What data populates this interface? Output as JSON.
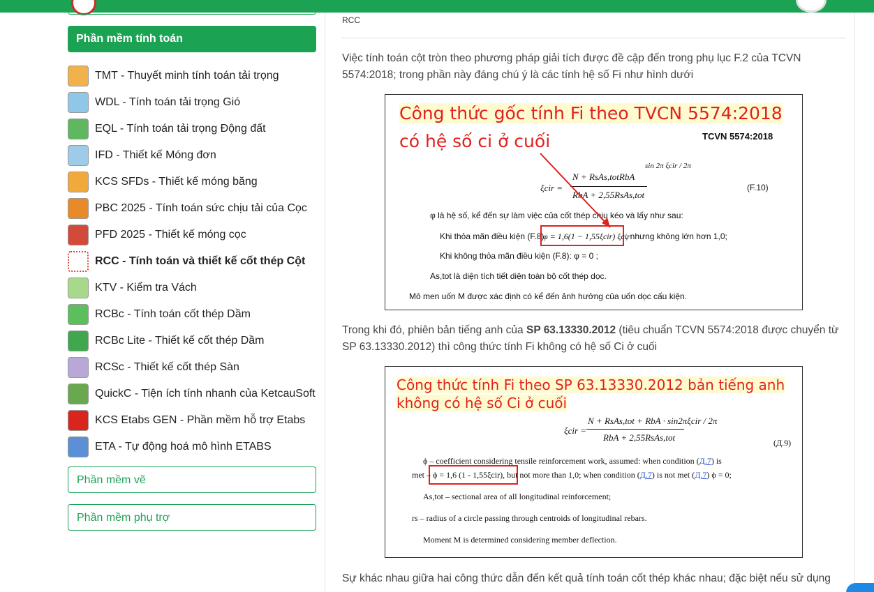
{
  "sidebar": {
    "active_header": "Phần mềm tính toán",
    "items": [
      {
        "label": "TMT - Thuyết minh tính toán tải trọng",
        "icon": "tmt-app-icon",
        "color": "#f2b24b"
      },
      {
        "label": "WDL - Tính toán tải trọng Gió",
        "icon": "wdl-app-icon",
        "color": "#8fc7e8"
      },
      {
        "label": "EQL - Tính toán tải trọng Động đất",
        "icon": "eql-app-icon",
        "color": "#5fb85f"
      },
      {
        "label": "IFD - Thiết kế Móng đơn",
        "icon": "ifd-app-icon",
        "color": "#9ecbe8"
      },
      {
        "label": "KCS SFDs - Thiết kế móng băng",
        "icon": "kcs-sfds-app-icon",
        "color": "#f2a93b"
      },
      {
        "label": "PBC 2025 - Tính toán sức chịu tải của Cọc",
        "icon": "pbc-app-icon",
        "color": "#e98a2a"
      },
      {
        "label": "PFD 2025 - Thiết kế móng cọc",
        "icon": "pfd-app-icon",
        "color": "#d24a3a"
      },
      {
        "label": "RCC - Tính toán và thiết kế cốt thép Cột",
        "icon": "rcc-app-icon",
        "color": "#ffffff",
        "active": true
      },
      {
        "label": "KTV - Kiểm tra Vách",
        "icon": "ktv-app-icon",
        "color": "#a8d98a"
      },
      {
        "label": "RCBc - Tính toán cốt thép Dầm",
        "icon": "rcbc-app-icon",
        "color": "#5cbf5c"
      },
      {
        "label": "RCBc Lite - Thiết kế cốt thép Dầm",
        "icon": "rcbc-lite-app-icon",
        "color": "#3fa84f"
      },
      {
        "label": "RCSc - Thiết kế cốt thép Sàn",
        "icon": "rcsc-app-icon",
        "color": "#b9a7d8"
      },
      {
        "label": "QuickC - Tiện ích tính nhanh của KetcauSoft",
        "icon": "quickc-app-icon",
        "color": "#6aa84f"
      },
      {
        "label": "KCS Etabs GEN - Phần mềm hỗ trợ Etabs",
        "icon": "set-app-icon",
        "color": "#d9261c"
      },
      {
        "label": "ETA - Tự động hoá mô hình ETABS",
        "icon": "eta-app-icon",
        "color": "#5b8fd6"
      }
    ],
    "collapsed": [
      "Phần mềm vẽ",
      "Phần mềm phụ trợ"
    ]
  },
  "main": {
    "breadcrumb": "RCC",
    "para1": "Việc tính toán cột tròn theo phương pháp giải tích được đề cập đến trong phụ lục F.2 của TCVN 5574:2018; trong phần này đáng chú ý là các tính hệ số Fi như hình dưới",
    "para2_before": "Trong khi đó, phiên bản tiếng anh của ",
    "para2_bold": "SP 63.13330.2012",
    "para2_after": " (tiêu chuẩn TCVN 5574:2018 được chuyển từ SP 63.13330.2012) thì công thức tính Fi không có hệ số Ci ở cuối",
    "para3": "Sự khác nhau giữa hai công thức dẫn đến kết quả tính toán cốt thép khác nhau; đặc biệt nếu sử dụng"
  },
  "figure1": {
    "title_line1": "Công thức gốc tính Fi theo TVCN 5574:2018",
    "title_line2": "có hệ số ci ở cuối",
    "std_label": "TCVN 5574:2018",
    "eq_lhs": "ξcir =",
    "eq_num": "N + RsAs,totRbA",
    "eq_num_frac": "sin 2π ξcir / 2π",
    "eq_den": "RbA + 2,55RsAs,tot",
    "eq_no": "(F.10)",
    "line_phi": "φ  là hệ số, kể đến sự làm việc của cốt thép chịu kéo và lấy như sau:",
    "line_cond1_pre": "Khi thỏa mãn điều kiện (F.8)",
    "line_cond1_box": "φ = 1,6(1 − 1,55ξcir) ξcir",
    "line_cond1_post": ", nhưng không lớn hơn 1,0;",
    "line_cond2": "Khi không thỏa mãn điều kiện (F.8):  φ = 0 ;",
    "line_as": "As,tot là diện tích tiết diện toàn bộ cốt thép dọc.",
    "line_m": "Mô men uốn  M  được xác định có kể đến ảnh hưởng của uốn dọc cấu kiện."
  },
  "figure2": {
    "title_line1": "Công thức tính Fi theo SP 63.13330.2012 bản tiếng anh",
    "title_line2": "không có hệ số Ci ở cuối",
    "eq_lhs": "ξcir =",
    "eq_num": "N + RsAs,tot + RbA · sin2πξcir / 2π",
    "eq_den": "RbA + 2,55RsAs,tot",
    "eq_no": "(Д.9)",
    "line_phi_pre": "ϕ – coefficient considering tensile reinforcement work, assumed: when condition (",
    "link": "Д.7",
    "line_phi_post": ") is",
    "line_met_pre": "met –",
    "line_met_box": "ϕ = 1,6 (1 - 1,55ξcir),",
    "line_met_mid": " but not more than 1,0; when condition (",
    "line_met_mid2": ") is not met (",
    "line_met_end": ") ϕ = 0;",
    "line_as": "As,tot – sectional area of all longitudinal reinforcement;",
    "line_rs": "rs – radius of a circle passing through centroids of longitudinal rebars.",
    "line_m": "Moment M is determined considering member deflection."
  }
}
